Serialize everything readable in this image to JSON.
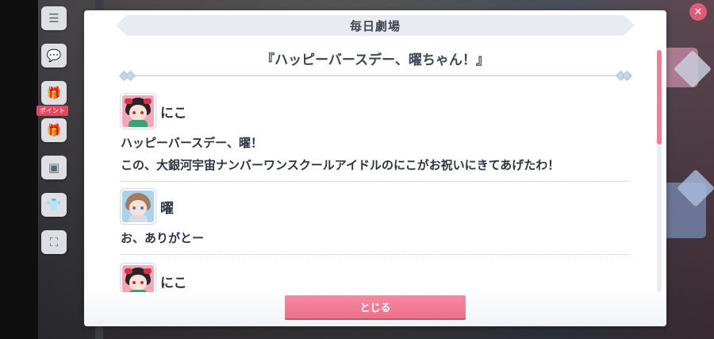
{
  "window_title": "毎日劇場",
  "story_title": "『ハッピーバースデー、曜ちゃん！』",
  "side_menu": {
    "items": [
      {
        "icon": "menu-icon",
        "glyph": "☰"
      },
      {
        "icon": "chat-icon",
        "glyph": "💬"
      },
      {
        "icon": "present-icon",
        "glyph": "🎁"
      },
      {
        "icon": "gift-icon",
        "glyph": "🎁"
      },
      {
        "icon": "theater-icon",
        "glyph": "▣"
      },
      {
        "icon": "costume-icon",
        "glyph": "👕"
      },
      {
        "icon": "fullscreen-icon",
        "glyph": "⛶"
      }
    ],
    "tag_label": "ポイント"
  },
  "entries": [
    {
      "speaker": "にこ",
      "avatar": "nico",
      "lines": [
        "ハッピーバースデー、曜！",
        "この、大銀河宇宙ナンバーワンスクールアイドルのにこがお祝いにきてあげたわ！"
      ]
    },
    {
      "speaker": "曜",
      "avatar": "you",
      "lines": [
        "お、ありがとー"
      ]
    },
    {
      "speaker": "にこ",
      "avatar": "nico",
      "lines": []
    }
  ],
  "close_button_label": "とじる",
  "scroll": {
    "position_fraction": 0.0,
    "visible_fraction": 0.39
  },
  "colors": {
    "accent": "#f27c94",
    "text": "#2e3440",
    "header_bg": "#e8ebef"
  }
}
